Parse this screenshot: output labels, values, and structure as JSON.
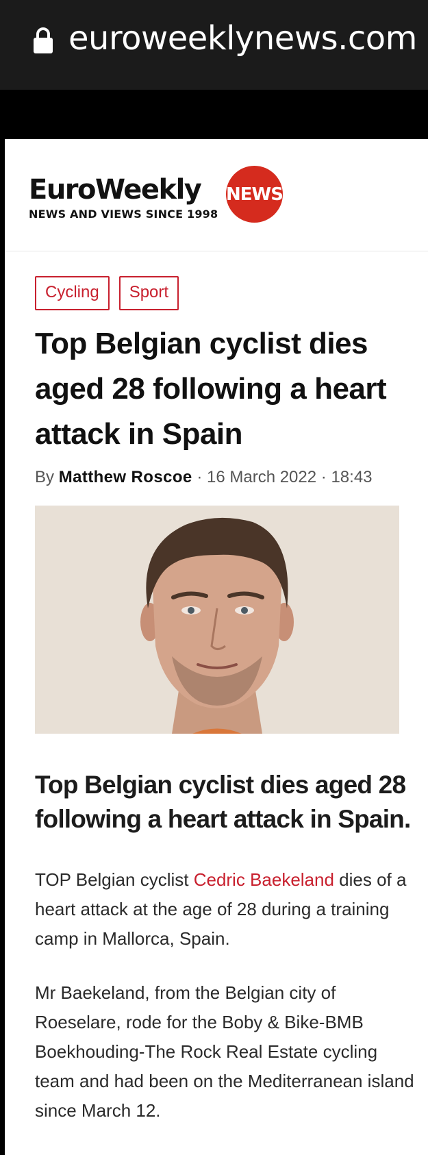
{
  "browser": {
    "url": "euroweeklynews.com",
    "lock_icon": "lock-icon"
  },
  "site": {
    "logo_word": "EuroWeekly",
    "logo_badge": "NEWS",
    "logo_tagline": "NEWS AND VIEWS SINCE 1998",
    "brand_color": "#d52b1e"
  },
  "article": {
    "categories": [
      "Cycling",
      "Sport"
    ],
    "title": "Top Belgian cyclist dies aged 28 following a heart attack in Spain",
    "byline": {
      "prefix": "By",
      "author": "Matthew Roscoe",
      "date": "16 March 2022",
      "time": "18:43"
    },
    "subheading": "Top Belgian cyclist dies aged 28 following a heart attack in Spain.",
    "paragraph1": {
      "before": "TOP Belgian cyclist ",
      "link": "Cedric Baekeland",
      "after": " dies of a heart attack at the age of 28 during a training camp in Mallorca, Spain."
    },
    "paragraph2": "Mr Baekeland, from the Belgian city of Roeselare, rode for the Boby & Bike-BMB Boekhouding-The Rock Real Estate cycling team and had been on the Mediterranean island since March 12."
  }
}
